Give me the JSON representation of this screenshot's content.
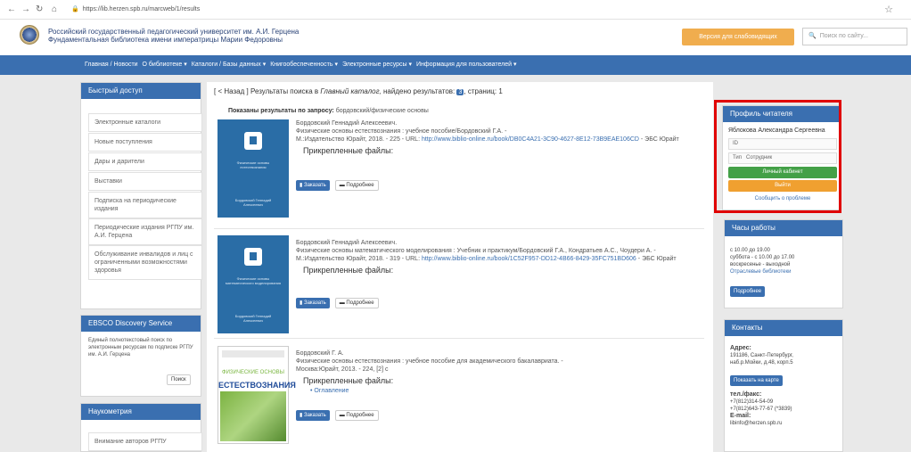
{
  "browser": {
    "url": "https://lib.herzen.spb.ru/marcweb/1/results"
  },
  "header": {
    "university": "Российский государственный педагогический университет им. А.И. Герцена",
    "library": "Фундаментальная библиотека имени императрицы Марии Федоровны",
    "vision_button": "Версия для слабовидящих",
    "search_placeholder": "Поиск по сайту..."
  },
  "navbar": {
    "items": [
      "Главная / Новости",
      "О библиотеке ▾",
      "Каталоги / Базы данных ▾",
      "Книгообеспеченность ▾",
      "Электронные ресурсы ▾",
      "Информация для пользователей ▾"
    ]
  },
  "sidebar": {
    "quick_title": "Быстрый доступ",
    "links": [
      "Электронные каталоги",
      "Новые поступления",
      "Дары и дарители",
      "Выставки",
      "Подписка на периодические издания",
      "Периодические издания РГПУ им. А.И. Герцена",
      "Обслуживание инвалидов и лиц с ограниченными возможностями здоровья"
    ],
    "ebsco_title": "EBSCO Discovery Service",
    "ebsco_text": "Единый полнотекстовый поиск по электронным ресурсам по подписке РГПУ им. А.И. Герцена",
    "ebsco_button": "Поиск",
    "scient_title": "Наукометрия",
    "scient_link": "Внимание авторов РГПУ"
  },
  "main": {
    "crumb_back": "[ < Назад ]",
    "crumb_text": "Результаты поиска в",
    "crumb_catalog": "Главный каталог,",
    "crumb_found": "найдено результатов:",
    "found_count": "3",
    "crumb_page": ", страниц: 1",
    "shown_label": "Показаны результаты по запросу:",
    "shown_query": "бордовский/физические основы",
    "attached_label": "Прикрепленные файлы:",
    "order_button": "Заказать",
    "details_button": "Подробнее",
    "records": [
      {
        "lines": [
          "Бордовский Геннадий Алексеевич.",
          "Физические основы естествознания : учебное пособие/Бордовский Г.А. -"
        ],
        "imprint": "М.:Издательство Юрайт, 2018. - 225 - URL:",
        "url": "http://www.biblio-online.ru/book/DB0C4A21-3C90-4627-8E12-73B9EAE106CD",
        "suffix": "- ЭБС Юрайт",
        "cover_title": "Физические основы естествознания",
        "cover_author": "Бордовский Геннадий Алексеевич"
      },
      {
        "lines": [
          "Бордовский Геннадий Алексеевич."
        ],
        "imprint": "Физические основы математического моделирования : Учебник и практикум/Бордовский Г.А., Кондратьев А.С., Чоудери А. -",
        "imprint2": "М.:Издательство Юрайт, 2018. - 319 - URL:",
        "url": "http://www.biblio-online.ru/book/1C52F957-DD12-4B66-8429-35FC751BD606",
        "suffix": "- ЭБС Юрайт",
        "cover_title": "Физические основы математического моделирования",
        "cover_author": "Бордовский Геннадий Алексеевич"
      },
      {
        "lines": [
          "Бордовский Г. А."
        ],
        "imprint": "Физические основы естествознания : учебное пособие для академического бакалавриата. -",
        "imprint2": "Москва:Юрайт, 2013. - 224, [2] с",
        "file_link": "Оглавление",
        "cover_green": "ФИЗИЧЕСКИЕ ОСНОВЫ",
        "cover_title": "ЕСТЕСТВОЗНАНИЯ"
      }
    ]
  },
  "profile": {
    "title": "Профиль читателя",
    "name": "Яблокова Александра Сергеевна",
    "id_label": "ID",
    "type_label": "Тип",
    "type_value": "Сотрудник",
    "cabinet_button": "Личный кабинет",
    "exit_button": "Выйти",
    "report_link": "Сообщить о проблеме"
  },
  "hours": {
    "title": "Часы работы",
    "lines": [
      "с 10.00 до 19.00",
      "суббота - с 10.00 до 17.00",
      "воскресенье - выходной"
    ],
    "link": "Отраслевые библиотеки",
    "button": "Подробнее"
  },
  "contacts": {
    "title": "Контакты",
    "address_label": "Адрес:",
    "address": [
      "191186, Санкт-Петербург,",
      "наб.р.Мойки, д.48, корп.5"
    ],
    "map_button": "Показать на карте",
    "phone_label": "тел./факс:",
    "phones": [
      "+7(812)314-54-09",
      "+7(812)643-77-67 (*3839)"
    ],
    "email_label": "E-mail:",
    "email": "libinfo@herzen.spb.ru"
  }
}
